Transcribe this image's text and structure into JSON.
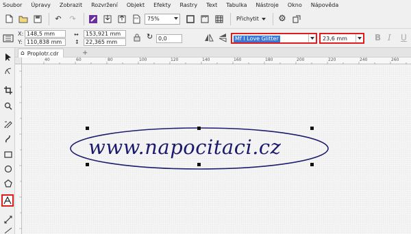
{
  "menu": [
    "Soubor",
    "Úpravy",
    "Zobrazit",
    "Rozvržení",
    "Objekt",
    "Efekty",
    "Rastry",
    "Text",
    "Tabulka",
    "Nástroje",
    "Okno",
    "Nápověda"
  ],
  "toolbar": {
    "zoom": "75%",
    "snap_label": "Přichytit",
    "icons": [
      "new-icon",
      "open-icon",
      "save-icon",
      "undo-icon",
      "redo-icon",
      "import-icon",
      "export-icon",
      "pdf-icon",
      "fullscreen-icon",
      "settings-icon"
    ]
  },
  "property_bar": {
    "x": "148,5 mm",
    "y": "110,838 mm",
    "width": "153,921 mm",
    "height": "22,365 mm",
    "x_label": "X:",
    "y_label": "Y:",
    "rotation": "0,0",
    "font_name": "Mf I Love Glitter",
    "font_size": "23,6 mm",
    "style_bold": "B",
    "style_italic": "I",
    "style_underline": "U"
  },
  "document_tab": {
    "name": "Proplotr.cdr",
    "add": "+"
  },
  "ruler": {
    "labels": [
      "40",
      "60",
      "80",
      "100",
      "120",
      "140",
      "160",
      "180",
      "200",
      "220",
      "240",
      "260"
    ]
  },
  "canvas": {
    "text": "www.napocitaci.cz",
    "text_color": "#1a1a6e",
    "ellipse_color": "#1a1a6e"
  }
}
